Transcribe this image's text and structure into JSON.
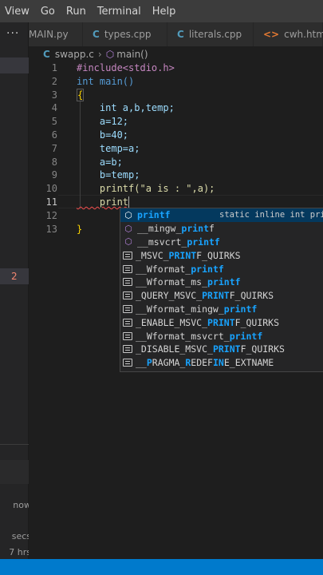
{
  "menu": [
    "View",
    "Go",
    "Run",
    "Terminal",
    "Help"
  ],
  "sidebar": {
    "dots": "···",
    "problem_count": "2",
    "timeline": [
      "now",
      "secs",
      "7 hrs"
    ]
  },
  "tabs": [
    {
      "label": "MAIN.py",
      "icon": ""
    },
    {
      "label": "types.cpp",
      "icon": "C"
    },
    {
      "label": "literals.cpp",
      "icon": "C"
    },
    {
      "label": "cwh.html",
      "icon": "<>"
    }
  ],
  "breadcrumb": {
    "file": "swapp.c",
    "symbol": "main()",
    "file_icon": "C"
  },
  "editor": {
    "line_numbers": [
      "1",
      "2",
      "3",
      "4",
      "5",
      "6",
      "7",
      "8",
      "9",
      "10",
      "11",
      "12",
      "13"
    ],
    "lines": [
      "#include<stdio.h>",
      "int main()",
      "{",
      "    int a,b,temp;",
      "    a=12;",
      "    b=40;",
      "    temp=a;",
      "    a=b;",
      "    b=temp;",
      "    printf(\"a is : \",a);",
      "    print",
      "",
      "}"
    ]
  },
  "suggestions": [
    {
      "pre": "",
      "match": "printf",
      "post": "",
      "detail": "static inline int print",
      "icon": "cube"
    },
    {
      "pre": "__mingw_",
      "match": "print",
      "post": "f",
      "icon": "cube"
    },
    {
      "pre": "__msvcrt_",
      "match": "printf",
      "post": "",
      "icon": "cube"
    },
    {
      "pre": "_MSVC_",
      "match": "PRINT",
      "post": "F_QUIRKS",
      "icon": "text"
    },
    {
      "pre": "__Wformat_",
      "match": "printf",
      "post": "",
      "icon": "text"
    },
    {
      "pre": "__Wformat_ms_",
      "match": "printf",
      "post": "",
      "icon": "text"
    },
    {
      "pre": "_QUERY_MSVC_",
      "match": "PRINT",
      "post": "F_QUIRKS",
      "icon": "text"
    },
    {
      "pre": "__Wformat_mingw_",
      "match": "printf",
      "post": "",
      "icon": "text"
    },
    {
      "pre": "_ENABLE_MSVC_",
      "match": "PRINT",
      "post": "F_QUIRKS",
      "icon": "text"
    },
    {
      "pre": "__Wformat_msvcrt_",
      "match": "printf",
      "post": "",
      "icon": "text"
    },
    {
      "pre": "_DISABLE_MSVC_",
      "match": "PRINT",
      "post": "F_QUIRKS",
      "icon": "text"
    },
    {
      "pre": "__",
      "match": "P",
      "post": "RAGMA_",
      "match2": "R",
      "post2": "EDEF",
      "match3": "IN",
      "post3": "E_EXTNAME",
      "icon": "text"
    }
  ]
}
